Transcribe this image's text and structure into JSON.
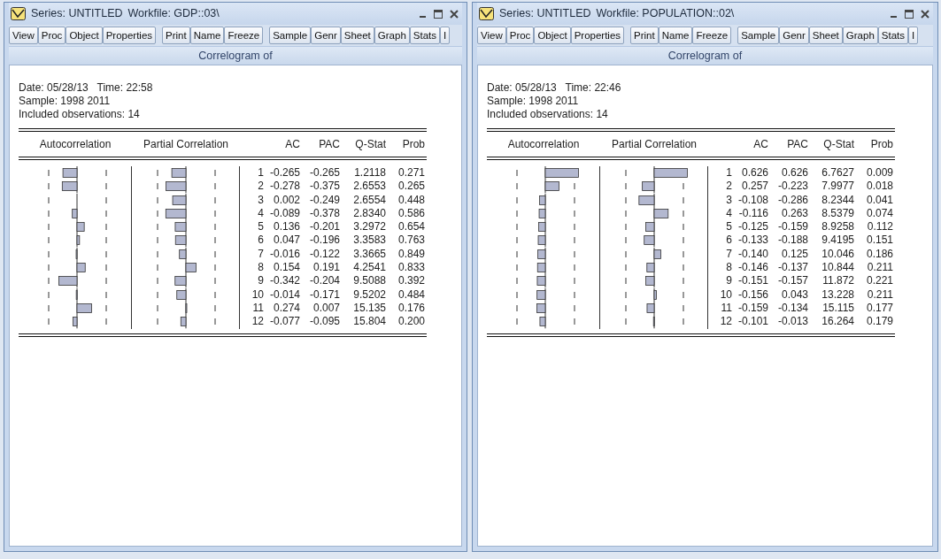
{
  "windows": [
    {
      "title": "Series: UNTITLED",
      "workfile": "Workfile: GDP::03\\",
      "toolbar_groups": [
        [
          "View",
          "Proc",
          "Object",
          "Properties"
        ],
        [
          "Print",
          "Name",
          "Freeze"
        ],
        [
          "Sample",
          "Genr",
          "Sheet",
          "Graph",
          "Stats",
          "I"
        ]
      ],
      "view_title": "Correlogram of",
      "info": [
        "Date: 05/28/13   Time: 22:58",
        "Sample: 1998 2011",
        "Included observations: 14"
      ],
      "columns": [
        "Autocorrelation",
        "Partial Correlation",
        "AC",
        "PAC",
        "Q-Stat",
        "Prob"
      ],
      "rows": [
        {
          "lag": "1",
          "ac": "-0.265",
          "pac": "-0.265",
          "q_stat": "1.2118",
          "prob": "0.271"
        },
        {
          "lag": "2",
          "ac": "-0.278",
          "pac": "-0.375",
          "q_stat": "2.6553",
          "prob": "0.265"
        },
        {
          "lag": "3",
          "ac": "0.002",
          "pac": "-0.249",
          "q_stat": "2.6554",
          "prob": "0.448"
        },
        {
          "lag": "4",
          "ac": "-0.089",
          "pac": "-0.378",
          "q_stat": "2.8340",
          "prob": "0.586"
        },
        {
          "lag": "5",
          "ac": "0.136",
          "pac": "-0.201",
          "q_stat": "3.2972",
          "prob": "0.654"
        },
        {
          "lag": "6",
          "ac": "0.047",
          "pac": "-0.196",
          "q_stat": "3.3583",
          "prob": "0.763"
        },
        {
          "lag": "7",
          "ac": "-0.016",
          "pac": "-0.122",
          "q_stat": "3.3665",
          "prob": "0.849"
        },
        {
          "lag": "8",
          "ac": "0.154",
          "pac": "0.191",
          "q_stat": "4.2541",
          "prob": "0.833"
        },
        {
          "lag": "9",
          "ac": "-0.342",
          "pac": "-0.204",
          "q_stat": "9.5088",
          "prob": "0.392"
        },
        {
          "lag": "10",
          "ac": "-0.014",
          "pac": "-0.171",
          "q_stat": "9.5202",
          "prob": "0.484"
        },
        {
          "lag": "11",
          "ac": "0.274",
          "pac": "0.007",
          "q_stat": "15.135",
          "prob": "0.176"
        },
        {
          "lag": "12",
          "ac": "-0.077",
          "pac": "-0.095",
          "q_stat": "15.804",
          "prob": "0.200"
        }
      ]
    },
    {
      "title": "Series: UNTITLED",
      "workfile": "Workfile: POPULATION::02\\",
      "toolbar_groups": [
        [
          "View",
          "Proc",
          "Object",
          "Properties"
        ],
        [
          "Print",
          "Name",
          "Freeze"
        ],
        [
          "Sample",
          "Genr",
          "Sheet",
          "Graph",
          "Stats",
          "I"
        ]
      ],
      "view_title": "Correlogram of",
      "info": [
        "Date: 05/28/13   Time: 22:46",
        "Sample: 1998 2011",
        "Included observations: 14"
      ],
      "columns": [
        "Autocorrelation",
        "Partial Correlation",
        "AC",
        "PAC",
        "Q-Stat",
        "Prob"
      ],
      "rows": [
        {
          "lag": "1",
          "ac": "0.626",
          "pac": "0.626",
          "q_stat": "6.7627",
          "prob": "0.009"
        },
        {
          "lag": "2",
          "ac": "0.257",
          "pac": "-0.223",
          "q_stat": "7.9977",
          "prob": "0.018"
        },
        {
          "lag": "3",
          "ac": "-0.108",
          "pac": "-0.286",
          "q_stat": "8.2344",
          "prob": "0.041"
        },
        {
          "lag": "4",
          "ac": "-0.116",
          "pac": "0.263",
          "q_stat": "8.5379",
          "prob": "0.074"
        },
        {
          "lag": "5",
          "ac": "-0.125",
          "pac": "-0.159",
          "q_stat": "8.9258",
          "prob": "0.112"
        },
        {
          "lag": "6",
          "ac": "-0.133",
          "pac": "-0.188",
          "q_stat": "9.4195",
          "prob": "0.151"
        },
        {
          "lag": "7",
          "ac": "-0.140",
          "pac": "0.125",
          "q_stat": "10.046",
          "prob": "0.186"
        },
        {
          "lag": "8",
          "ac": "-0.146",
          "pac": "-0.137",
          "q_stat": "10.844",
          "prob": "0.211"
        },
        {
          "lag": "9",
          "ac": "-0.151",
          "pac": "-0.157",
          "q_stat": "11.872",
          "prob": "0.221"
        },
        {
          "lag": "10",
          "ac": "-0.156",
          "pac": "0.043",
          "q_stat": "13.228",
          "prob": "0.211"
        },
        {
          "lag": "11",
          "ac": "-0.159",
          "pac": "-0.134",
          "q_stat": "15.115",
          "prob": "0.177"
        },
        {
          "lag": "12",
          "ac": "-0.101",
          "pac": "-0.013",
          "q_stat": "16.264",
          "prob": "0.179"
        }
      ]
    }
  ]
}
